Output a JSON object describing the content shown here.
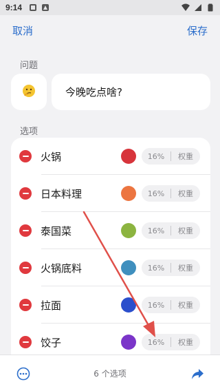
{
  "status_bar": {
    "time": "9:14"
  },
  "nav": {
    "cancel_label": "取消",
    "save_label": "保存"
  },
  "question": {
    "section_label": "问题",
    "emoji": "🤔",
    "text": "今晚吃点啥?"
  },
  "options": {
    "section_label": "选项",
    "items": [
      {
        "label": "火锅",
        "color": "#d7343b",
        "weight": "16%",
        "weight_label": "权重"
      },
      {
        "label": "日本料理",
        "color": "#ec7540",
        "weight": "16%",
        "weight_label": "权重"
      },
      {
        "label": "泰国菜",
        "color": "#8cb440",
        "weight": "16%",
        "weight_label": "权重"
      },
      {
        "label": "火锅底料",
        "color": "#3f8fbe",
        "weight": "16%",
        "weight_label": "权重"
      },
      {
        "label": "拉面",
        "color": "#2b4fcc",
        "weight": "16%",
        "weight_label": "权重"
      },
      {
        "label": "饺子",
        "color": "#7b35c9",
        "weight": "16%",
        "weight_label": "权重"
      }
    ]
  },
  "bottom_bar": {
    "count_text": "6 个选项"
  },
  "colors": {
    "accent": "#2c6ecb",
    "remove": "#e0393e",
    "annotation_arrow": "#e0504a"
  },
  "icons": {
    "more": "more-circle-icon",
    "share": "share-arrow-icon"
  }
}
